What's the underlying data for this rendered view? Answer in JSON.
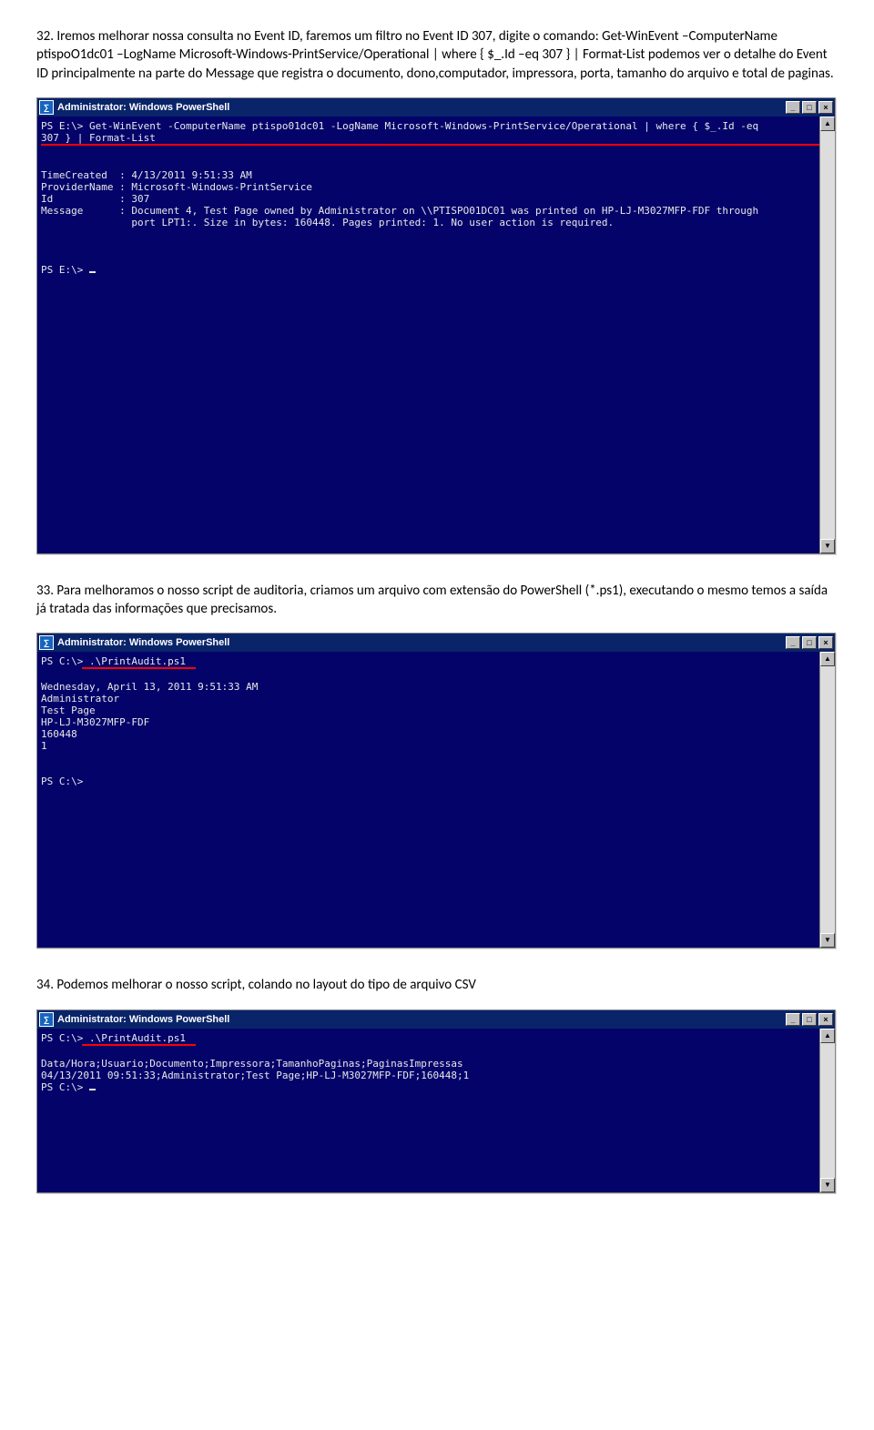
{
  "para32": "32. Iremos melhorar nossa consulta no Event ID, faremos um filtro no Event ID 307, digite o comando: Get-WinEvent –ComputerName ptispoO1dc01 –LogName Microsoft-Windows-PrintService/Operational | where { $_.Id –eq 307 } | Format-List podemos ver o detalhe do Event ID principalmente na parte do Message que registra o documento, dono,computador, impressora, porta, tamanho do arquivo e total de paginas.",
  "para33": "33. Para melhoramos o nosso script de auditoria, criamos um arquivo com extensão do PowerShell (*.ps1), executando o mesmo temos a saída já tratada das informações que precisamos.",
  "para34": "34. Podemos melhorar o nosso script, colando no layout do tipo de arquivo CSV",
  "wins": {
    "title": "Administrator: Windows PowerShell",
    "iconGlyph": "∑"
  },
  "console1": {
    "cmd1": "PS E:\\> Get-WinEvent -ComputerName ptispo01dc01 -LogName Microsoft-Windows-PrintService/Operational | where { $_.Id -eq",
    "cmd2": "307 } | Format-List",
    "blank1": "",
    "l1": "TimeCreated  : 4/13/2011 9:51:33 AM",
    "l2": "ProviderName : Microsoft-Windows-PrintService",
    "l3": "Id           : 307",
    "l4": "Message      : Document 4, Test Page owned by Administrator on \\\\PTISPO01DC01 was printed on HP-LJ-M3027MFP-FDF through",
    "l5": "               port LPT1:. Size in bytes: 160448. Pages printed: 1. No user action is required.",
    "prompt": "PS E:\\> "
  },
  "console2": {
    "cmd": "PS C:\\> .\\PrintAudit.ps1",
    "l1": "Wednesday, April 13, 2011 9:51:33 AM",
    "l2": "Administrator",
    "l3": "Test Page",
    "l4": "HP-LJ-M3027MFP-FDF",
    "l5": "160448",
    "l6": "1",
    "prompt": "PS C:\\>"
  },
  "console3": {
    "cmd": "PS C:\\> .\\PrintAudit.ps1",
    "l1": "Data/Hora;Usuario;Documento;Impressora;TamanhoPaginas;PaginasImpressas",
    "l2": "04/13/2011 09:51:33;Administrator;Test Page;HP-LJ-M3027MFP-FDF;160448;1",
    "prompt": "PS C:\\> "
  }
}
